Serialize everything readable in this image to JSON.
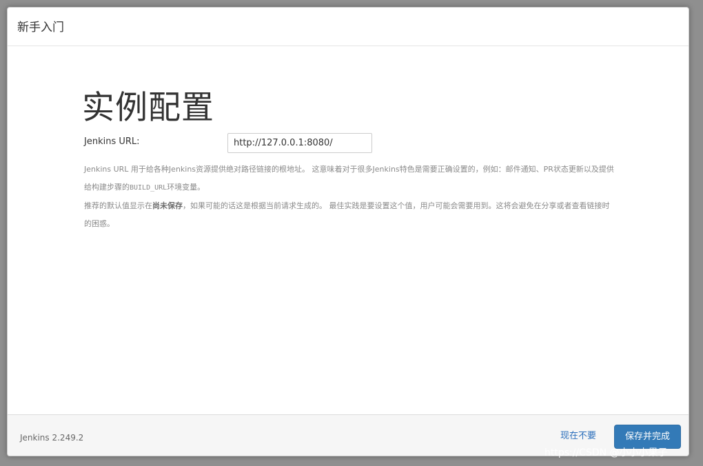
{
  "dialog": {
    "title": "新手入门"
  },
  "main": {
    "heading": "实例配置",
    "url_label": "Jenkins URL:",
    "url_value": "http://127.0.0.1:8080/",
    "help": {
      "p1_before_code": "Jenkins URL 用于给各种Jenkins资源提供绝对路径链接的根地址。 这意味着对于很多Jenkins特色是需要正确设置的，例如：邮件通知、PR状态更新以及提供给构建步骤的",
      "p1_code": "BUILD_URL",
      "p1_after_code": "环境变量。",
      "p2_before_strong": "推荐的默认值显示在",
      "p2_strong": "尚未保存",
      "p2_after_strong": "，如果可能的话这是根据当前请求生成的。 最佳实践是要设置这个值，用户可能会需要用到。这将会避免在分享或者查看链接时的困惑。"
    }
  },
  "footer": {
    "version": "Jenkins 2.249.2",
    "skip_label": "现在不要",
    "save_label": "保存并完成"
  },
  "watermark": "https://CSDN @小小小果子"
}
